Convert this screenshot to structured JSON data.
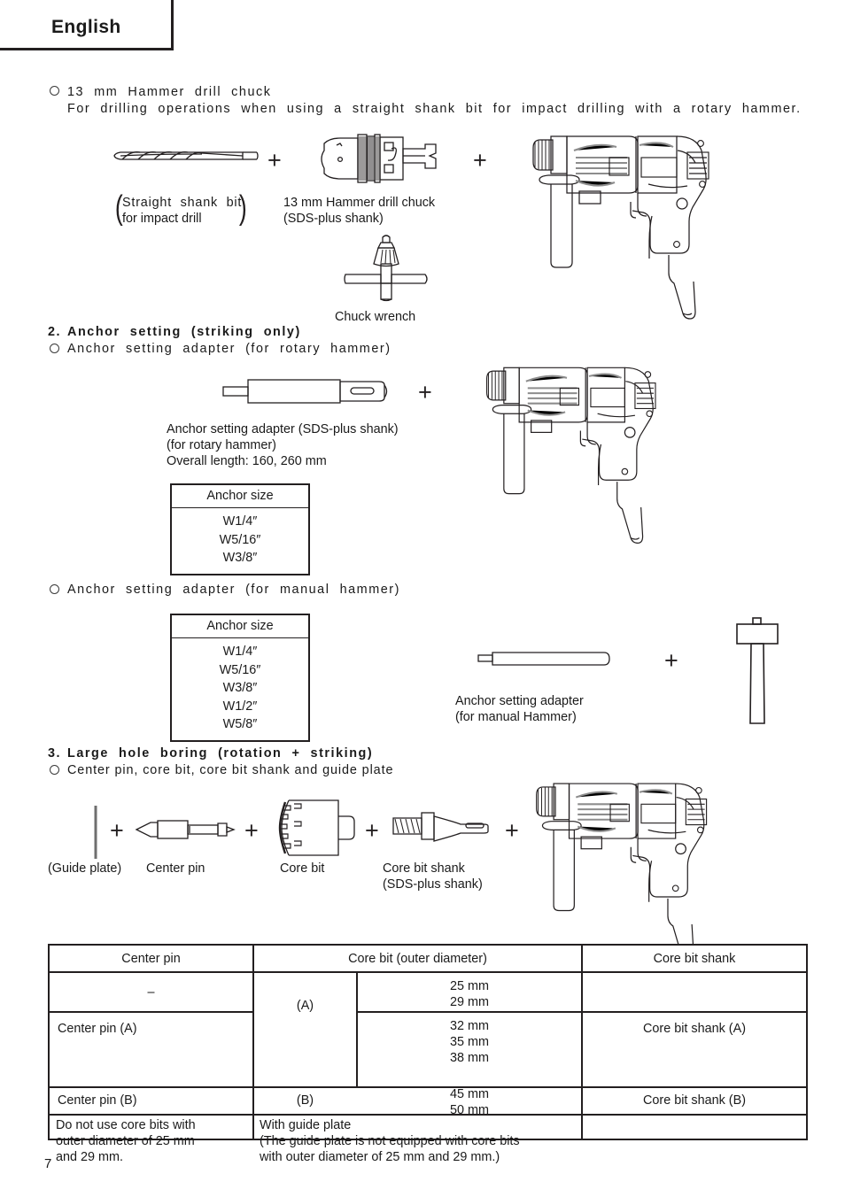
{
  "header": {
    "title": "English"
  },
  "page_number": "7",
  "section1": {
    "bullet_title": "13  mm  Hammer  drill  chuck",
    "bullet_desc": "For  drilling  operations  when  using  a  straight  shank  bit  for  impact  drilling  with  a  rotary  hammer.",
    "label_bit_line1": "Straight  shank  bit",
    "label_bit_line2": "for impact drill",
    "label_chuck_line1": "13 mm Hammer drill chuck",
    "label_chuck_line2": "(SDS-plus shank)",
    "label_wrench": "Chuck wrench",
    "plus1": "+",
    "plus2": "+"
  },
  "section2": {
    "heading_num": "2.",
    "heading": "Anchor  setting  (striking  only)",
    "bullet_rotary": "Anchor  setting  adapter  (for  rotary  hammer)",
    "adapter_line1": "Anchor setting adapter (SDS-plus shank)",
    "adapter_line2": "(for rotary hammer)",
    "adapter_line3": "Overall length: 160, 260 mm",
    "plus": "+",
    "table_rotary": {
      "header": "Anchor size",
      "rows": [
        "W1/4″",
        "W5/16″",
        "W3/8″"
      ]
    },
    "bullet_manual": "Anchor  setting  adapter  (for  manual  hammer)",
    "table_manual": {
      "header": "Anchor size",
      "rows": [
        "W1/4″",
        "W5/16″",
        "W3/8″",
        "W1/2″",
        "W5/8″"
      ]
    },
    "manual_label_line1": "Anchor setting adapter",
    "manual_label_line2": "(for manual Hammer)",
    "manual_plus": "+"
  },
  "section3": {
    "heading_num": "3.",
    "heading": "Large  hole  boring  (rotation  +  striking)",
    "bullet": "Center pin, core bit, core bit shank and guide plate",
    "label_guide_plate": "(Guide plate)",
    "label_center_pin": "Center pin",
    "label_core_bit": "Core bit",
    "label_core_bit_shank_line1": "Core bit shank",
    "label_core_bit_shank_line2": "(SDS-plus shank)",
    "plus1": "+",
    "plus2": "+",
    "plus3": "+",
    "plus4": "+"
  },
  "main_table": {
    "columns": [
      "Center pin",
      "Core bit (outer diameter)",
      "Core bit shank"
    ],
    "rows": [
      {
        "center_pin": "–",
        "core_group": "(A)",
        "diameters": [
          "25 mm",
          "29 mm"
        ],
        "shank": "Core bit shank (A)"
      },
      {
        "center_pin": "Center pin (A)",
        "core_group": "(A)",
        "diameters": [
          "32 mm",
          "35 mm",
          "38 mm"
        ],
        "shank": "Core bit shank (A)"
      },
      {
        "center_pin": "Center pin (B)",
        "core_group": "(B)",
        "diameters": [
          "45 mm",
          "50 mm"
        ],
        "shank": "Core bit shank (B)"
      }
    ],
    "note_left_line1": "Do not use core bits with",
    "note_left_line2": "outer diameter of 25 mm",
    "note_left_line3": "and 29 mm.",
    "note_mid_line1": "With guide plate",
    "note_mid_line2": "(The guide plate is not equipped with core bits",
    "note_mid_line3": "with outer diameter of 25 mm and 29 mm.)",
    "note_right": ""
  }
}
